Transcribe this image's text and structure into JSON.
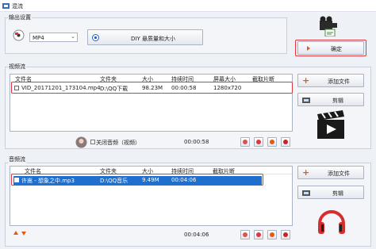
{
  "window": {
    "title": "混流"
  },
  "output": {
    "group_title": "输出设置",
    "format_value": "MP4",
    "quality_label": "DIY 悬质量和大小",
    "confirm_label": "确定"
  },
  "video": {
    "group_title": "视频流",
    "columns": [
      "文件名",
      "文件夹",
      "大小",
      "持续时间",
      "屏幕大小",
      "截取片断"
    ],
    "rows": [
      {
        "name": "VID_20171201_173104.mp4",
        "folder": "D:\\QQ下载",
        "size": "98.23M",
        "duration": "00:00:58",
        "screen": "1280x720",
        "clip": ""
      }
    ],
    "add_label": "添加文件",
    "clip_label": "剪辑",
    "mute_label": "关闭音频（视频）",
    "total_time": "00:00:58"
  },
  "audio": {
    "group_title": "音频流",
    "columns": [
      "文件名",
      "文件夹",
      "大小",
      "持续时间",
      "截取片断"
    ],
    "rows": [
      {
        "name": "许嵩 - 想象之中.mp3",
        "folder": "D:\\QQ音乐",
        "size": "9.49M",
        "duration": "00:04:06",
        "clip": ""
      }
    ],
    "add_label": "添加文件",
    "clip_label": "剪辑",
    "total_time": "00:04:06"
  },
  "colors": {
    "accent": "#e0363c",
    "selection": "#1f6fcf",
    "orange": "#e35a12"
  }
}
